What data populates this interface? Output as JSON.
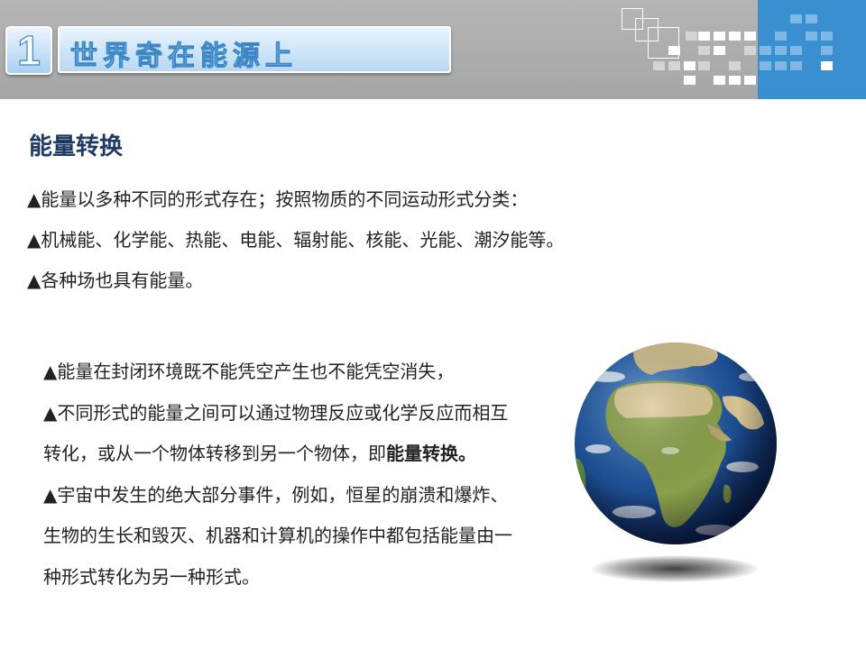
{
  "slide": {
    "number": "1",
    "title": "世界奇在能源上",
    "section_title": "能量转换",
    "lines": [
      "▲能量以多种不同的形式存在；按照物质的不同运动形式分类：",
      "▲机械能、化学能、热能、电能、辐射能、核能、光能、潮汐能等。",
      "▲各种场也具有能量。"
    ],
    "paragraph": {
      "line1": "▲能量在封闭环境既不能凭空产生也不能凭空消失，",
      "line2": "▲不同形式的能量之间可以通过物理反应或化学反应而相互转化，或从一个物体转移到另一个物体，即",
      "emphasis": "能量转换。",
      "line3": "▲宇宙中发生的绝大部分事件，例如，恒星的崩溃和爆炸、生物的生长和毁灭、机器和计算机的操作中都包括能量由一种形式转化为另一种形式。"
    }
  },
  "colors": {
    "header_gray": "#a6a6a6",
    "header_blue": "#3a8fd1",
    "title_text": "#1f3b63",
    "ocean": "#1f4f8f",
    "land": "#7a9a3a"
  },
  "icons": {
    "image": "earth-globe-illustration"
  }
}
